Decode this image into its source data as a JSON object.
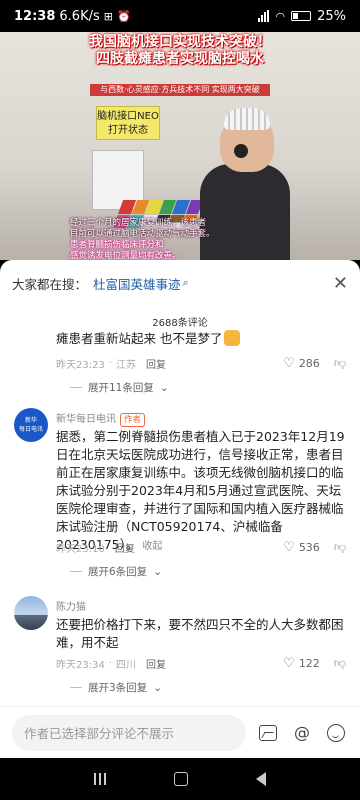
{
  "status_bar": {
    "time": "12:38",
    "speed": "6.6K/s",
    "battery": "25%"
  },
  "video": {
    "headline_line1": "我国脑机接口实现技术突破！",
    "headline_line2": "四肢截瘫患者实现脑控喝水",
    "sub_strip": "与西数·心灵感应·方兵技术不同 实现两大突破",
    "neo_label_line1": "脑机接口NEO",
    "neo_label_line2": "打开状态",
    "caption_line1": "经过三个月的居家康复训练，该患者",
    "caption_line2": "目前可以通过脑电活动驱动气动手套。",
    "caption_line3": "患者脊髓损伤临床评分和",
    "caption_line4": "感觉诱发电位测量均有改善。"
  },
  "sheet": {
    "search_prefix": "大家都在搜：",
    "search_keyword": "杜富国英雄事迹",
    "comment_count": "2688条评论"
  },
  "comments": [
    {
      "text": "瘫患者重新站起来 也不是梦了",
      "time": "昨天23:23",
      "location": "江苏",
      "reply": "回复",
      "likes": "286",
      "expand": "展开11条回复"
    },
    {
      "user": "新华每日电讯",
      "tag": "作者",
      "text": "据悉，第二例脊髓损伤患者植入已于2023年12月19日在北京天坛医院成功进行，信号接收正常，患者目前正在居家康复训练中。该项无线微创脑机接口的临床试验分别于2023年4月和5月通过宣武医院、天坛医院伦理审查，并进行了国际和国内植入医疗器械临床试验注册（NCT05920174、沪械临备20230175）。",
      "fold": "收起",
      "time": "昨天23:10",
      "reply": "回复",
      "likes": "536",
      "expand": "展开6条回复"
    },
    {
      "user": "陈力猫",
      "text": "还要把价格打下来，要不然四只不全的人大多数都困难，用不起",
      "time": "昨天23:34",
      "location": "四川",
      "reply": "回复",
      "likes": "122",
      "expand": "展开3条回复"
    }
  ],
  "input_bar": {
    "placeholder": "作者已选择部分评论不展示"
  },
  "colors": {
    "link_blue": "#1e5fa8",
    "author_tag": "#f06a3c",
    "headline_shadow": "#cc0000"
  }
}
